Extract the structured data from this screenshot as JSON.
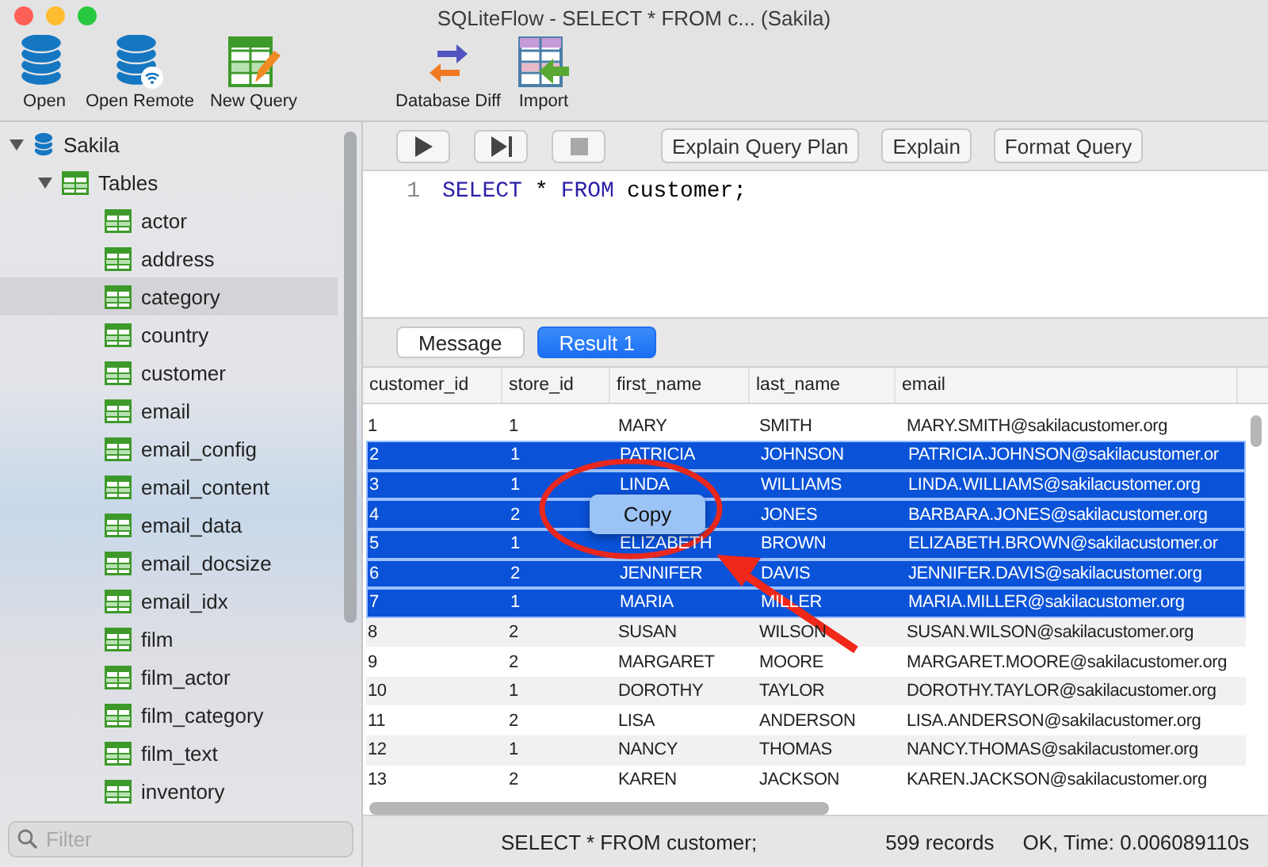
{
  "window": {
    "title": "SQLiteFlow  -  SELECT * FROM c... (Sakila)"
  },
  "toolbar": [
    {
      "label": "Open",
      "kind": "database"
    },
    {
      "label": "Open Remote",
      "kind": "remote"
    },
    {
      "label": "New Query",
      "kind": "query"
    },
    {
      "label": "Database Diff",
      "kind": "diff"
    },
    {
      "label": "Import",
      "kind": "import"
    }
  ],
  "sidebar": {
    "tree": [
      {
        "name": "Sakila",
        "kind": "database",
        "expanded": true,
        "selected": false,
        "children": [
          {
            "name": "Tables",
            "kind": "folder",
            "expanded": true,
            "selected": false,
            "children": [
              {
                "name": "actor",
                "kind": "table",
                "selected": false
              },
              {
                "name": "address",
                "kind": "table",
                "selected": false
              },
              {
                "name": "category",
                "kind": "table",
                "selected": true
              },
              {
                "name": "country",
                "kind": "table",
                "selected": false
              },
              {
                "name": "customer",
                "kind": "table",
                "selected": false
              },
              {
                "name": "email",
                "kind": "table",
                "selected": false
              },
              {
                "name": "email_config",
                "kind": "table",
                "selected": false
              },
              {
                "name": "email_content",
                "kind": "table",
                "selected": false
              },
              {
                "name": "email_data",
                "kind": "table",
                "selected": false
              },
              {
                "name": "email_docsize",
                "kind": "table",
                "selected": false
              },
              {
                "name": "email_idx",
                "kind": "table",
                "selected": false
              },
              {
                "name": "film",
                "kind": "table",
                "selected": false
              },
              {
                "name": "film_actor",
                "kind": "table",
                "selected": false
              },
              {
                "name": "film_category",
                "kind": "table",
                "selected": false
              },
              {
                "name": "film_text",
                "kind": "table",
                "selected": false
              },
              {
                "name": "inventory",
                "kind": "table",
                "selected": false
              }
            ]
          }
        ]
      }
    ],
    "filter": {
      "placeholder": "Filter"
    }
  },
  "query_bar": {
    "run_buttons": [
      {
        "kind": "run",
        "disabled": false
      },
      {
        "kind": "step",
        "disabled": false
      },
      {
        "kind": "stop",
        "disabled": true
      }
    ],
    "buttons": [
      "Explain Query Plan",
      "Explain",
      "Format Query"
    ]
  },
  "editor": {
    "lines": [
      {
        "number": "1",
        "tokens": [
          {
            "text": "SELECT",
            "kind": "keyword"
          },
          {
            "text": "*",
            "kind": "plain"
          },
          {
            "text": "FROM",
            "kind": "keyword"
          },
          {
            "text": "customer;",
            "kind": "plain"
          }
        ]
      }
    ]
  },
  "result_tabs": [
    {
      "label": "Message",
      "selected": false
    },
    {
      "label": "Result 1",
      "selected": true
    }
  ],
  "table": {
    "columns": [
      "customer_id",
      "store_id",
      "first_name",
      "last_name",
      "email"
    ],
    "rows": [
      {
        "selected": false,
        "cells": [
          "1",
          "1",
          "MARY",
          "SMITH",
          "MARY.SMITH@sakilacustomer.org"
        ]
      },
      {
        "selected": true,
        "cells": [
          "2",
          "1",
          "PATRICIA",
          "JOHNSON",
          "PATRICIA.JOHNSON@sakilacustomer.or"
        ]
      },
      {
        "selected": true,
        "cells": [
          "3",
          "1",
          "LINDA",
          "WILLIAMS",
          "LINDA.WILLIAMS@sakilacustomer.org"
        ]
      },
      {
        "selected": true,
        "cells": [
          "4",
          "2",
          null,
          "JONES",
          "BARBARA.JONES@sakilacustomer.org"
        ]
      },
      {
        "selected": true,
        "cells": [
          "5",
          "1",
          "ELIZABETH",
          "BROWN",
          "ELIZABETH.BROWN@sakilacustomer.or"
        ]
      },
      {
        "selected": true,
        "cells": [
          "6",
          "2",
          "JENNIFER",
          "DAVIS",
          "JENNIFER.DAVIS@sakilacustomer.org"
        ]
      },
      {
        "selected": true,
        "cells": [
          "7",
          "1",
          "MARIA",
          "MILLER",
          "MARIA.MILLER@sakilacustomer.org"
        ]
      },
      {
        "selected": false,
        "cells": [
          "8",
          "2",
          "SUSAN",
          "WILSON",
          "SUSAN.WILSON@sakilacustomer.org"
        ]
      },
      {
        "selected": false,
        "cells": [
          "9",
          "2",
          "MARGARET",
          "MOORE",
          "MARGARET.MOORE@sakilacustomer.org"
        ]
      },
      {
        "selected": false,
        "cells": [
          "10",
          "1",
          "DOROTHY",
          "TAYLOR",
          "DOROTHY.TAYLOR@sakilacustomer.org"
        ]
      },
      {
        "selected": false,
        "cells": [
          "11",
          "2",
          "LISA",
          "ANDERSON",
          "LISA.ANDERSON@sakilacustomer.org"
        ]
      },
      {
        "selected": false,
        "cells": [
          "12",
          "1",
          "NANCY",
          "THOMAS",
          "NANCY.THOMAS@sakilacustomer.org"
        ]
      },
      {
        "selected": false,
        "cells": [
          "13",
          "2",
          "KAREN",
          "JACKSON",
          "KAREN.JACKSON@sakilacustomer.org"
        ]
      }
    ]
  },
  "context_menu": {
    "items": [
      "Copy"
    ]
  },
  "status_bar": {
    "query": "SELECT * FROM customer;",
    "records": "599 records",
    "result": "OK, Time: 0.006089110s"
  }
}
